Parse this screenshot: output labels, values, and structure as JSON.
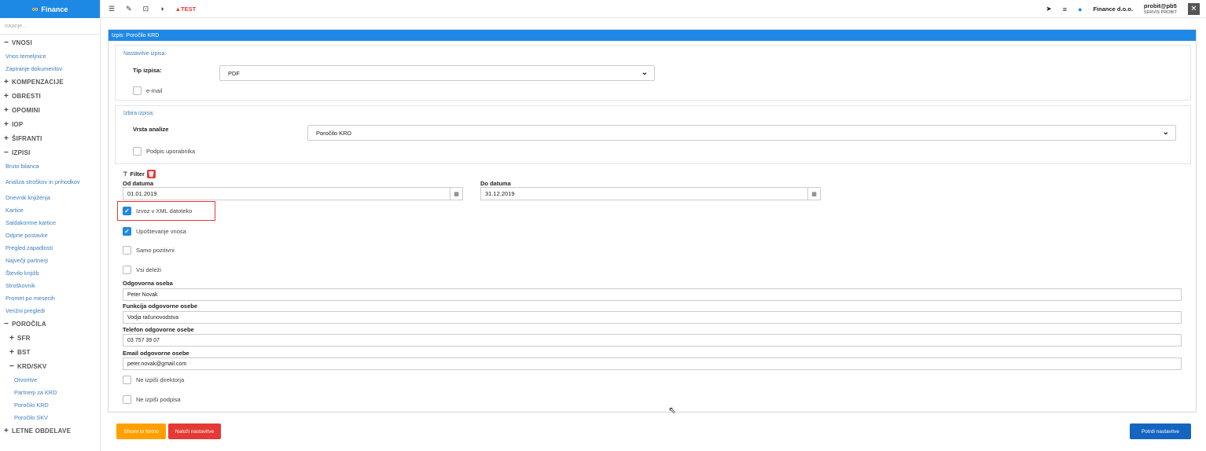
{
  "brand": {
    "logo": "∞",
    "name": "Finance"
  },
  "sidebar": {
    "search_placeholder": "Iskanje...",
    "items": [
      {
        "type": "section",
        "sign": "−",
        "label": "VNOSI"
      },
      {
        "type": "link",
        "label": "Vnos temeljnice"
      },
      {
        "type": "link",
        "label": "Zapiranje dokumentov"
      },
      {
        "type": "section",
        "sign": "+",
        "label": "KOMPENZACIJE"
      },
      {
        "type": "section",
        "sign": "+",
        "label": "OBRESTI"
      },
      {
        "type": "section",
        "sign": "+",
        "label": "OPOMINI"
      },
      {
        "type": "section",
        "sign": "+",
        "label": "IOP"
      },
      {
        "type": "section",
        "sign": "+",
        "label": "ŠIFRANTI"
      },
      {
        "type": "section",
        "sign": "−",
        "label": "IZPISI"
      },
      {
        "type": "link",
        "label": "Bruto bilanca"
      },
      {
        "type": "link2",
        "label": "Analiza stroškov in prihodkov"
      },
      {
        "type": "link",
        "label": "Dnevnik knjiženja"
      },
      {
        "type": "link",
        "label": "Kartice"
      },
      {
        "type": "link",
        "label": "Saldakontne kartice"
      },
      {
        "type": "link",
        "label": "Odprte postavke"
      },
      {
        "type": "link",
        "label": "Pregled zapadlosti"
      },
      {
        "type": "link",
        "label": "Največji partnerji"
      },
      {
        "type": "link",
        "label": "Število knjižb"
      },
      {
        "type": "link",
        "label": "Stroškovnik"
      },
      {
        "type": "link",
        "label": "Promet po mesecih"
      },
      {
        "type": "link",
        "label": "Verižni pregledi"
      },
      {
        "type": "section",
        "sign": "−",
        "label": "POROČILA"
      },
      {
        "type": "subsection",
        "sign": "+",
        "label": "SFR"
      },
      {
        "type": "subsection",
        "sign": "+",
        "label": "BST"
      },
      {
        "type": "subsection",
        "sign": "−",
        "label": "KRD/SKV"
      },
      {
        "type": "deeplink",
        "label": "Otvoritve"
      },
      {
        "type": "deeplink",
        "label": "Partnerji za KRD"
      },
      {
        "type": "deeplink",
        "label": "Poročilo KRD"
      },
      {
        "type": "deeplink",
        "label": "Poročilo SKV"
      },
      {
        "type": "section",
        "sign": "+",
        "label": "LETNE OBDELAVE"
      }
    ]
  },
  "topbar": {
    "test_label": "TEST",
    "company": "Finance d.o.o.",
    "user": "probit@pb5",
    "user_sub": "SERVIS PROBIT",
    "icons": [
      "list-icon",
      "edit-icon",
      "lock-icon",
      "contrast-icon",
      "warning-icon",
      "send-icon",
      "menu-icon",
      "info-icon",
      "close-icon"
    ]
  },
  "panel": {
    "title": "Izpis: Poročilo KRD",
    "settings": {
      "title": "Nastavitve izpisa:",
      "type_label": "Tip izpisa:",
      "type_value": "PDF",
      "email_label": "e-mail",
      "email_checked": false
    },
    "selection": {
      "title": "Izbira izpisa:",
      "analysis_label": "Vrsta analize",
      "analysis_value": "Poročilo KRD",
      "signature_label": "Podpis uporabnika",
      "signature_checked": false
    },
    "filter": {
      "label": "Filter",
      "from_label": "Od datuma",
      "from_value": "01.01.2019",
      "to_label": "Do datuma",
      "to_value": "31.12.2019",
      "xml_label": "Izvoz v XML datoteko",
      "xml_checked": true,
      "include_label": "Upoštevanje vnosa",
      "include_checked": true,
      "positive_label": "Samo pozitivni",
      "positive_checked": false,
      "shares_label": "Vsi deleži",
      "shares_checked": false,
      "person_label": "Odgovorna oseba",
      "person_value": "Peter Novak",
      "function_label": "Funkcija odgovorne osebe",
      "function_value": "Vodja računovodstva",
      "phone_label": "Telefon odgovorne osebe",
      "phone_value": "03 757 39 07",
      "email_label": "Email odgovorne osebe",
      "email_value": "peter.novak@gmail.com",
      "no_director_label": "Ne izpiši direktorja",
      "no_director_checked": false,
      "no_signature_label": "Ne izpiši podpisa",
      "no_signature_checked": false
    }
  },
  "buttons": {
    "save": "Shrani to formo",
    "load": "Naloži nastavitve",
    "confirm": "Potrdi nastavitve"
  },
  "colors": {
    "accent": "#1e88e5",
    "danger": "#e53935",
    "warning": "#ffa000",
    "primary_dark": "#1565c0"
  }
}
